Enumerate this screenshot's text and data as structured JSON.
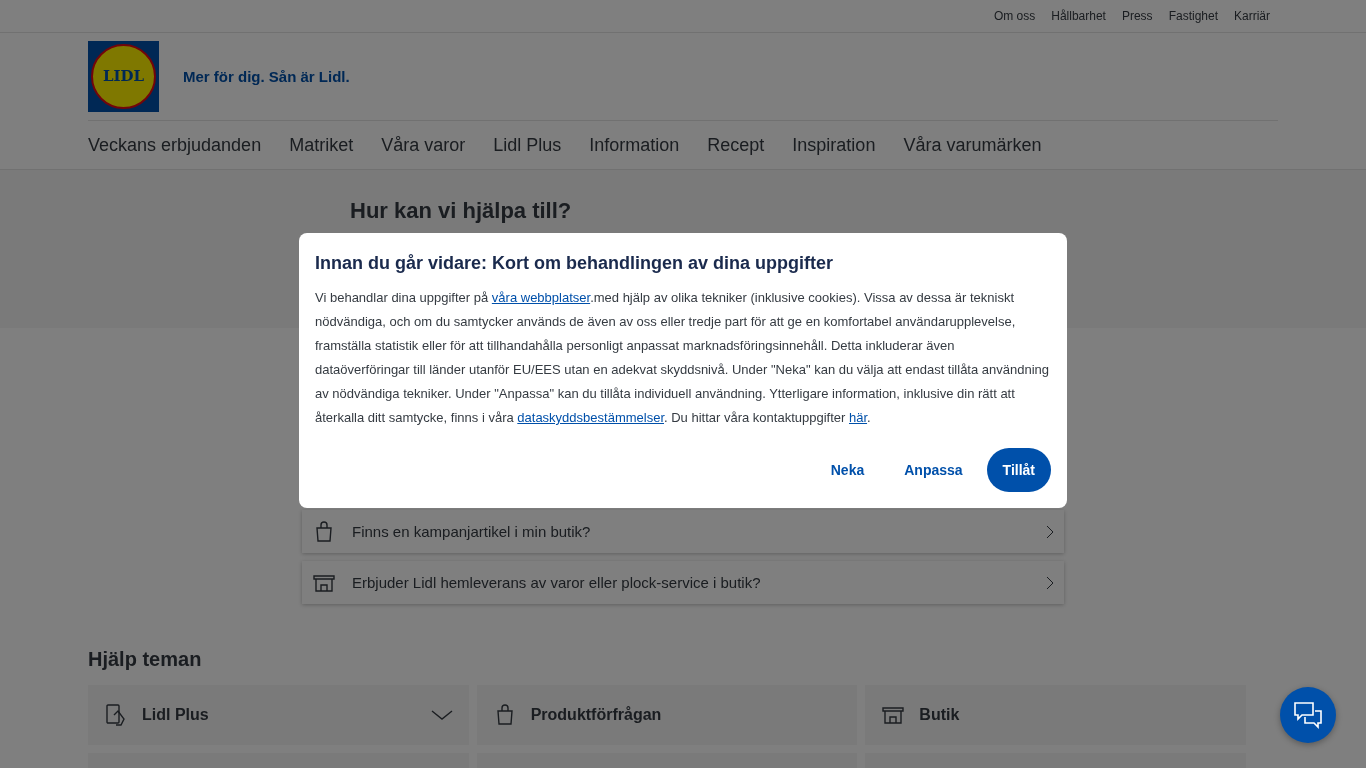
{
  "top_links": [
    "Om oss",
    "Hållbarhet",
    "Press",
    "Fastighet",
    "Karriär"
  ],
  "header": {
    "logo_text": "LIDL",
    "tagline": "Mer för dig. Sån är Lidl."
  },
  "nav": [
    "Veckans erbjudanden",
    "Matriket",
    "Våra varor",
    "Lidl Plus",
    "Information",
    "Recept",
    "Inspiration",
    "Våra varumärken"
  ],
  "hero": {
    "title": "Hur kan vi hjälpa till?"
  },
  "faq": [
    {
      "kind": "bag",
      "text": "Finns en kampanjartikel i min butik?"
    },
    {
      "kind": "store",
      "text": "Erbjuder Lidl hemleverans av varor eller plock-service i butik?"
    }
  ],
  "themes": {
    "title": "Hjälp teman",
    "cards": [
      {
        "kind": "hand",
        "label": "Lidl Plus",
        "expanded": false
      },
      {
        "kind": "bag",
        "label": "Produktförfrågan"
      },
      {
        "kind": "store",
        "label": "Butik"
      }
    ]
  },
  "consent": {
    "title": "Innan du går vidare: Kort om behandlingen av dina uppgifter",
    "body": [
      {
        "kind": "text",
        "text": "Vi behandlar dina uppgifter på "
      },
      {
        "kind": "link",
        "text": "våra webbplatser"
      },
      {
        "kind": "text",
        "text": ".med hjälp av olika tekniker (inklusive cookies). Vissa av dessa är tekniskt nödvändiga, och om du samtycker används de även av oss eller tredje part för att ge en komfortabel användarupplevelse, framställa statistik eller för att tillhandahålla personligt anpassat marknadsföringsinnehåll. Detta inkluderar även dataöverföringar till länder utanför EU/EES utan en adekvat skyddsnivå. Under \"Neka\" kan du välja att endast tillåta användning av nödvändiga tekniker. Under \"Anpassa\" kan du tillåta individuell användning. Ytterligare information, inklusive din rätt att återkalla ditt samtycke, finns i våra "
      },
      {
        "kind": "link",
        "text": "dataskyddsbestämmelser"
      },
      {
        "kind": "text",
        "text": ". Du hittar våra kontaktuppgifter "
      },
      {
        "kind": "link",
        "text": "här"
      },
      {
        "kind": "text",
        "text": "."
      }
    ],
    "buttons": [
      {
        "kind": "plain",
        "label": "Neka"
      },
      {
        "kind": "plain",
        "label": "Anpassa"
      },
      {
        "kind": "primary",
        "label": "Tillåt"
      }
    ]
  }
}
